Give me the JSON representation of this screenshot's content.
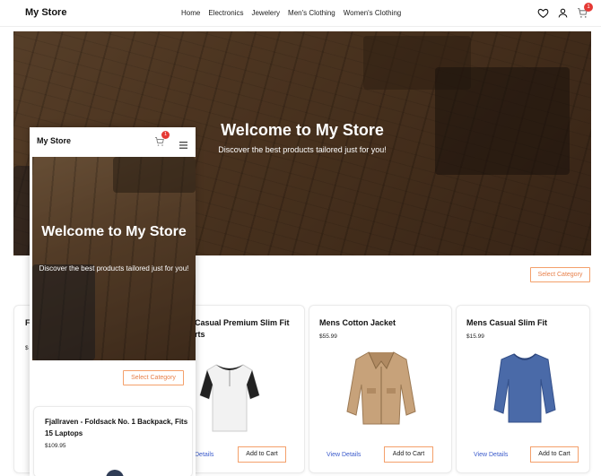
{
  "navbar": {
    "brand": "My Store",
    "links": [
      "Home",
      "Electronics",
      "Jewelery",
      "Men's Clothing",
      "Women's Clothing"
    ],
    "icons": [
      "heart-icon",
      "user-icon",
      "cart-icon"
    ],
    "cart_count": "1"
  },
  "hero": {
    "title": "Welcome to My Store",
    "subtitle": "Discover the best products tailored just for you!"
  },
  "filter": {
    "select_label": "Select Category"
  },
  "products": [
    {
      "title": "Fjallraven - Foldsack No. 1 Backpack, Fits 15 Laptops",
      "title_visible": "Fj B",
      "price": "$"
    },
    {
      "title": "Mens Casual Premium Slim Fit T-Shirts",
      "title_line1": "Casual Premium Slim Fit",
      "title_line2": "rts",
      "view_label": "Details",
      "cart_label": "Add to Cart"
    },
    {
      "title": "Mens Cotton Jacket",
      "price": "$55.99",
      "view_label": "View Details",
      "cart_label": "Add to Cart"
    },
    {
      "title": "Mens Casual Slim Fit",
      "price": "$15.99",
      "view_label": "View Details",
      "cart_label": "Add to Cart"
    }
  ],
  "mobile": {
    "brand": "My Store",
    "cart_count": "1",
    "hero_title": "Welcome to My Store",
    "hero_subtitle": "Discover the best products tailored just for you!",
    "select_label": "Select Category",
    "product_title": "Fjallraven - Foldsack No. 1 Backpack, Fits 15 Laptops",
    "product_price": "$109.95"
  },
  "colors": {
    "accent_orange": "#f4a06b",
    "link_blue": "#3b5bcc",
    "badge_red": "#e53935"
  }
}
